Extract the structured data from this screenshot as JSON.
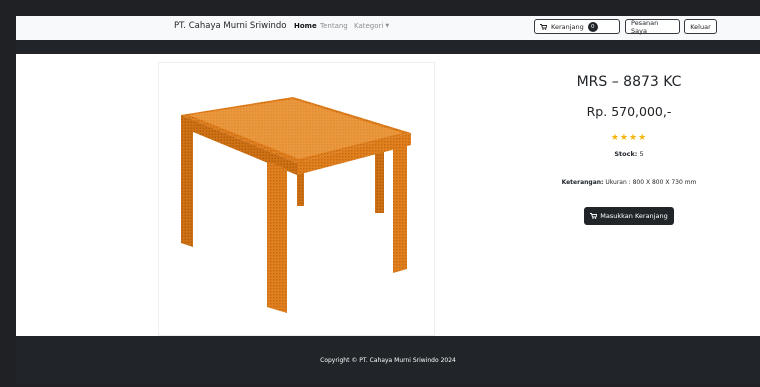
{
  "navbar": {
    "brand": "PT. Cahaya Murni Sriwindo",
    "links": {
      "home": "Home",
      "about": "Tentang",
      "category": "Kategori"
    },
    "cart": {
      "label": "Keranjang",
      "count": "0"
    },
    "orders_label": "Pesanan Saya",
    "logout_label": "Keluar"
  },
  "product": {
    "name": "MRS – 8873 KC",
    "price": "Rp. 570,000,-",
    "rating_stars": "★★★★",
    "rating": 4,
    "stock_label": "Stock:",
    "stock_value": "5",
    "description_label": "Keterangan:",
    "description_value": "Ukuran : 800 X 800 X 730 mm",
    "add_to_cart_label": "Masukkan Keranjang",
    "image_alt": "orange-rattan-square-table"
  },
  "footer": {
    "copyright": "Copyright © PT. Cahaya Murni Sriwindo 2024"
  },
  "colors": {
    "dark": "#212529",
    "star": "#f5b50a",
    "table_orange": "#e0801e"
  }
}
